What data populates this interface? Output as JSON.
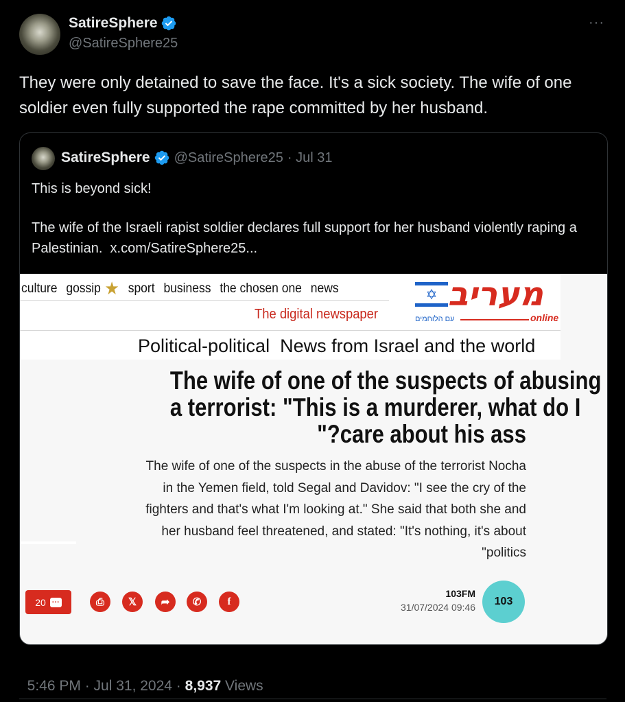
{
  "tweet": {
    "author_name": "SatireSphere",
    "author_handle": "@SatireSphere25",
    "more_icon": "ellipsis-icon",
    "text": "They were only detained to save the face. It's a sick society. The wife of one soldier even fully supported the rape committed by her husband.",
    "time": "5:46 PM · Jul 31, 2024 · ",
    "views_count": "8,937",
    "views_label": " Views"
  },
  "quoted": {
    "author_name": "SatireSphere",
    "author_handle": "@SatireSphere25",
    "date": "· Jul 31",
    "line1": "This is beyond sick!",
    "line2": "The wife of the Israeli rapist soldier declares full support for her husband violently raping a Palestinian.",
    "link": "x.com/SatireSphere25..."
  },
  "article": {
    "nav": [
      "culture",
      "gossip",
      "sport",
      "business",
      "the chosen one",
      "news"
    ],
    "tagline": "The digital newspaper",
    "logo_text": "מעריב",
    "logo_sub": "עם הלוחמים",
    "logo_online": "online",
    "section": "Political-political  News from Israel and the world",
    "headline_1": "The wife of one of the suspects of abusing",
    "headline_2": "a terrorist: \"This is a murderer, what do I",
    "headline_3": "\"?care about his ass",
    "body_1": "The wife of one of the suspects in the abuse of the terrorist Nocha",
    "body_2": "in the Yemen field, told Segal and Davidov: \"I see the cry of the",
    "body_3": "fighters and that's what I'm looking at.\" She said that both she and",
    "body_4": "her husband feel threatened, and stated: \"It's nothing, it's about",
    "body_5": "\"politics",
    "comments_count": "20",
    "source": "103FM",
    "source_date": "31/07/2024 09:46",
    "source_logo": "103",
    "share_icons": [
      "print-icon",
      "x-icon",
      "share-icon",
      "whatsapp-icon",
      "facebook-icon"
    ]
  },
  "colors": {
    "background": "#000000",
    "verified": "#1d9bf0",
    "secondary_text": "#71767b",
    "accent_red": "#d72b1f",
    "logo_teal": "#5ccfd0"
  }
}
